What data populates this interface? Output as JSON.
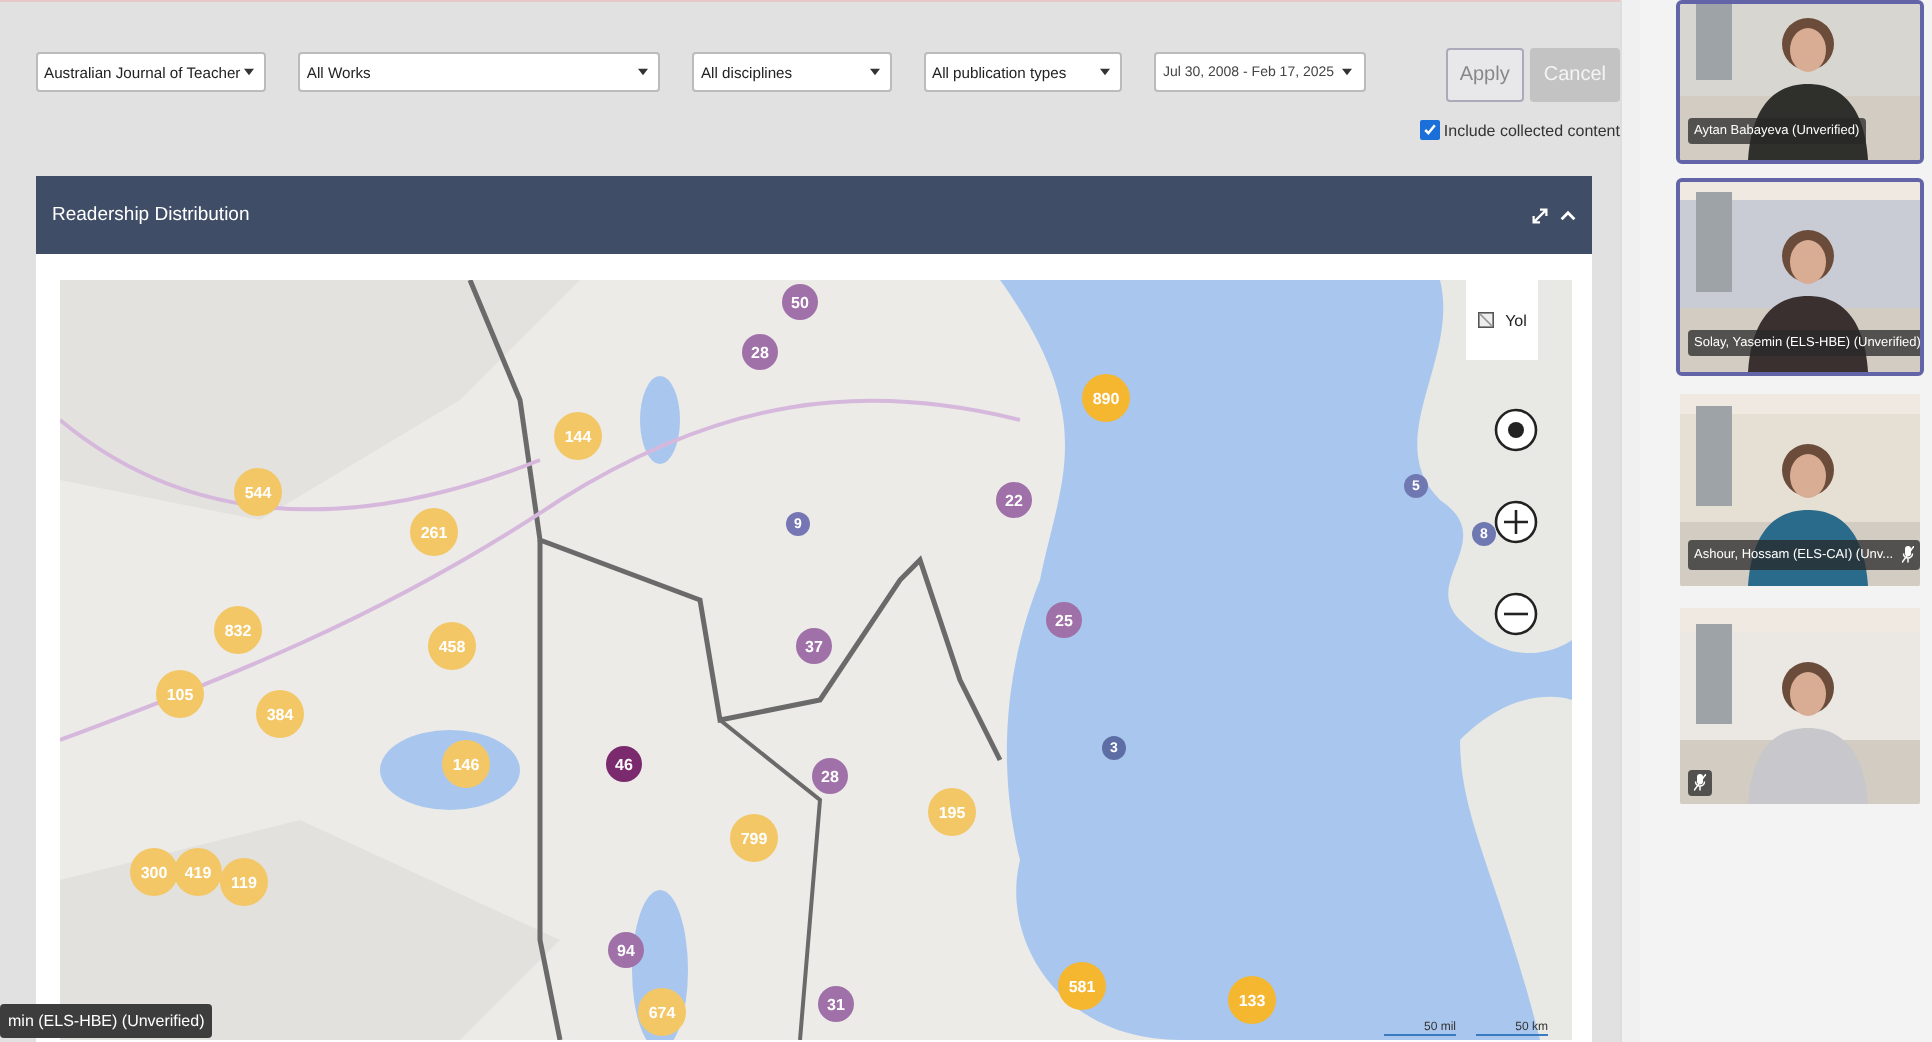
{
  "filters": [
    {
      "value": "Australian Journal of Teacher"
    },
    {
      "value": "All Works"
    },
    {
      "value": "All disciplines"
    },
    {
      "value": "All publication types"
    }
  ],
  "date_range": "Jul 30, 2008 - Feb 17, 2025",
  "buttons": [
    {
      "label": "Apply",
      "disabled": false
    },
    {
      "label": "Cancel",
      "disabled": true
    }
  ],
  "include_collected": {
    "label": "Include collected content",
    "checked": true
  },
  "panel": {
    "title": "Readership Distribution",
    "map": {
      "layer_button": "Yol",
      "scale": [
        "50 mil",
        "50 km"
      ],
      "markers": [
        {
          "label": "50",
          "color": "#a070a8"
        },
        {
          "label": "28",
          "color": "#a070a8"
        },
        {
          "label": "890",
          "color": "#f5b630"
        },
        {
          "label": "144",
          "color": "#f3c766"
        },
        {
          "label": "544",
          "color": "#f3c766"
        },
        {
          "label": "22",
          "color": "#a070a8"
        },
        {
          "label": "9",
          "color": "#7676b4"
        },
        {
          "label": "5",
          "color": "#6f78b0"
        },
        {
          "label": "8",
          "color": "#6f78b0"
        },
        {
          "label": "261",
          "color": "#f3c766"
        },
        {
          "label": "832",
          "color": "#f3c766"
        },
        {
          "label": "458",
          "color": "#f3c766"
        },
        {
          "label": "25",
          "color": "#a070a8"
        },
        {
          "label": "37",
          "color": "#a070a8"
        },
        {
          "label": "105",
          "color": "#f3c766"
        },
        {
          "label": "384",
          "color": "#f3c766"
        },
        {
          "label": "46",
          "color": "#7b2a6e"
        },
        {
          "label": "146",
          "color": "#f3c766"
        },
        {
          "label": "28",
          "color": "#a070a8"
        },
        {
          "label": "195",
          "color": "#f3c766"
        },
        {
          "label": "3",
          "color": "#5d6ea4"
        },
        {
          "label": "799",
          "color": "#f3c766"
        },
        {
          "label": "300",
          "color": "#f3c766"
        },
        {
          "label": "419",
          "color": "#f3c766"
        },
        {
          "label": "119",
          "color": "#f3c766"
        },
        {
          "label": "94",
          "color": "#a070a8"
        },
        {
          "label": "674",
          "color": "#f3c766"
        },
        {
          "label": "31",
          "color": "#a070a8"
        },
        {
          "label": "581",
          "color": "#f5b630"
        },
        {
          "label": "133",
          "color": "#f5b630"
        }
      ]
    }
  },
  "floating_name_tag": "min (ELS-HBE) (Unverified)",
  "participants": [
    {
      "name": "Aytan Babayeva (Unverified)",
      "selected": true,
      "muted": false
    },
    {
      "name": "Solay, Yasemin (ELS-HBE) (Unverified)",
      "selected": true,
      "muted": false
    },
    {
      "name": "Ashour, Hossam (ELS-CAI) (Unv...",
      "selected": false,
      "muted": true
    },
    {
      "selected": false,
      "muted": true
    }
  ]
}
